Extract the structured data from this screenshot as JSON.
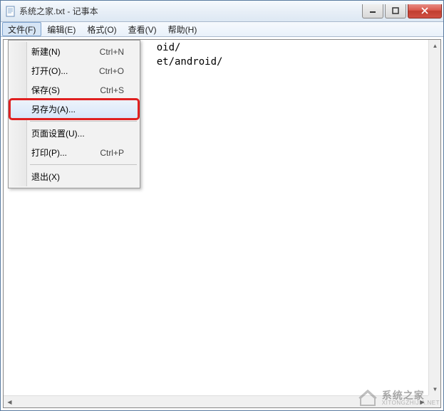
{
  "titlebar": {
    "title": "系统之家.txt - 记事本"
  },
  "menubar": {
    "file": "文件(F)",
    "edit": "编辑(E)",
    "format": "格式(O)",
    "view": "查看(V)",
    "help": "帮助(H)"
  },
  "dropdown": {
    "new_label": "新建(N)",
    "new_shortcut": "Ctrl+N",
    "open_label": "打开(O)...",
    "open_shortcut": "Ctrl+O",
    "save_label": "保存(S)",
    "save_shortcut": "Ctrl+S",
    "saveas_label": "另存为(A)...",
    "pagesetup_label": "页面设置(U)...",
    "print_label": "打印(P)...",
    "print_shortcut": "Ctrl+P",
    "exit_label": "退出(X)"
  },
  "editor": {
    "content": "                         oid/\n                         et/android/"
  },
  "watermark": {
    "zh": "系统之家",
    "en": "XITONGZHIJIA.NET"
  }
}
